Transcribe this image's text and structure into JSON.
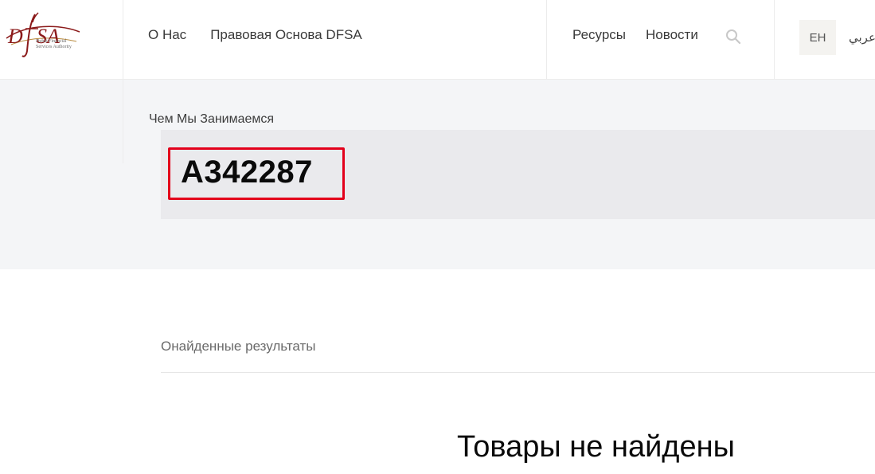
{
  "brand": {
    "logo_alt": "DFSA",
    "logo_subtitle": "Dubai Financial Services Authority",
    "logo_color": "#8b1a1a"
  },
  "nav": {
    "left_items": [
      {
        "label": "О Нас"
      },
      {
        "label": "Правовая Основа DFSA"
      }
    ],
    "right_items": [
      {
        "label": "Ресурсы"
      },
      {
        "label": "Новости"
      }
    ],
    "search_icon": "search-icon",
    "lang_en": "EH",
    "lang_ar": "عربي"
  },
  "hero": {
    "breadcrumb": "Чем Мы Занимаемся",
    "query": "A342287",
    "highlight_color": "#e3001b"
  },
  "results": {
    "label": "Онайденные результаты",
    "empty_message": "Товары не найдены"
  }
}
